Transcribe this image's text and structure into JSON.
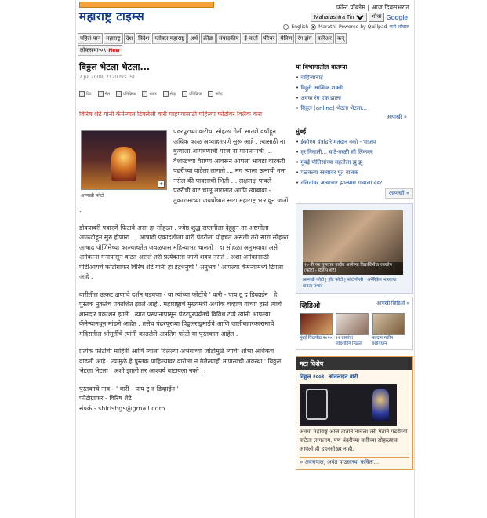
{
  "header": {
    "logo": "महाराष्ट्र टाइम्स",
    "toplinks": "फॉन्ट प्रॉब्लेम | आज दिवसभरात",
    "search_option": "Maharashtra Times",
    "search_button": "शोधा",
    "google": "Google",
    "lang_english": "English",
    "lang_marathi": "Marathi",
    "powered": "Powered by Quillpad",
    "powered_link": "कसे शोधाल"
  },
  "nav": {
    "row1": [
      "पहिलं पान",
      "महाराष्ट्र",
      "देश",
      "विदेश",
      "ग्लोबल महाराष्ट्र",
      "अर्थ",
      "क्रीडा",
      "संपादकीय",
      "ई-वार्ता",
      "फीचर",
      "मैत्रिण",
      "रंग झंग",
      "करिअर",
      "कन्"
    ],
    "row2_label": "लोकसभा-०९",
    "row2_badge": "New"
  },
  "article": {
    "title": "विठ्ठल भेटला भेटला...",
    "date": "2 Jul 2009, 2120 hrs IST",
    "tools": [
      "प्रिंट",
      "मेल",
      "प्रतिक्रिया",
      "शेअर",
      "सेव्ह",
      "प्रतिक्रिया",
      "फॉन्ट"
    ],
    "lead": "विरिष शेटे यांनी कॅमेऱ्यात टिपलेली वारी पाहण्यासाठी पहिल्या फोटोवर क्लिक करा.",
    "photo_caption": "आणखी फोटो",
    "para1": "पंढरपूरच्या वारीचा सोहळा गेली सातशे वर्षांहून अधिक काळ अव्याहतपणे सुरू आहे . त्यासाठी ना कुणाला आमंत्रणाची गरज ना मानपानाची ... वैशाखच्या वैराण्य आवरून आपला भावडा वारकरी पंढरीच्या वाटेला लागतो ... मग त्याला ऊनाची तमा नसेल की पावसाची भिती ... लक्षलक्ष पावले पंढरीची वाट चालू लागतात आणि त्याबाबा - तुकारामाच्या जयघोषात सारा महाराष्ट्र भारावून जातो .",
    "para2": "डोक्यावरी पवारणे फिटावे असा हा सोहळा . ज्येष्ठ शुद्ध सप्तमीला देहूहून तर अष्टमीला आळंदीहून सुरु होणारा ... आषाढी एकादशीला वारी पंढरीला पोहचत असली तरी सारा सोहळा आषाढ पौर्णिमेच्या काल्याचतेत जवळपास महिन्याभर चालतो . हा सोहळा अनुभवावा असे अनेकांना मनापासून वाटत असले तरी प्रत्येकाला जाणे शक्य नसते . अशा अनेकांसाठी पीटीआयचे फोटोग्राफर विरिष शेटे यांनी हा इंद्रधनुषी ' अनुभव ' आपल्या कॅमेऱ्यामध्ये टिपला आहे .",
    "para3": "वारीतील उत्कट क्षणांचे दर्शन घडवणा - या त्यांच्या फोटोंचे ' वारी - पाय टू द डिव्हाईन ' हे पुस्तक नुकतेच प्रकाशित झाले आहे . महाराष्ट्राचे मुख्यमंत्री अशोक चव्हाण यांच्या हस्ते त्याचे शानदार प्रकाशन झाले . त्यात प्रस्थानापासून पंढरपुरपर्यंतचे विविध टप्पे त्यांनी आपल्या कॅमेऱ्यामधून मांडले आहेत . तसेच पंढरपूरच्या विठ्ठलरखुमाईचे आणि जातीबहारकारामाचे मंदिरातील श्रीमूर्तीचे त्यांनी काढलेले अप्रतिम फोटो या पुस्तकात आहेत .",
    "para4": "प्रत्येक फोटोची माहिती आणि त्याला दिलेल्या अभंगाच्या जोडीमुळे त्याची शोभा अधिकच वाढली आहे . त्यामुळे हे पुस्तक पाहिल्यावर वारीला न गेलेल्याही माणसाची अवस्था ' विठ्ठल भेटला भेटला ' अशी झाली तर आश्चर्य वाटायला नको .",
    "book": "पुस्तकाचे नाव - ' वारी - पाय टू द डिव्हाईन '",
    "photographer": "फोटोग्राफर - विरिष शेटे",
    "contact": "संपर्क - shirishgs@gmail.com"
  },
  "sidebar": {
    "section1_title": "या विभागातील बातम्या",
    "section1_items": [
      "वाहिन्याबाई",
      "विठ्ठुरी आत्मिक शक्ती",
      "अवघा रंग एक झाला",
      "विठ्ठल (online) भेटला भेटला..."
    ],
    "section1_more": "आणखी »",
    "section2_title": "मुंबई",
    "section2_items": [
      "ईव्हीएम यंत्रांद्वारे मतदान नको - भाजप",
      "दूर निघाली... घाटे-वरळी सी लिंकवर",
      "मुंबई पोलिसांच्या महतीला झु झु",
      "पळवल्या रस्त्यावर मूत बालक",
      "दलितांवर अत्याचार झाल्यास गावाला दंड?"
    ],
    "section2_more": "आणखी »",
    "photo_caption": "१० वी च्या गुणवत्ता यादीत आलेल्या विद्यार्थिनींचा जल्लोष (फोटो - दिलीप शेटे)",
    "photo_links": "आणखी फोटो | हॉट फोटो | फोटोगॅलरी | अमेरिकेत भारताचा वाढता प्रभाव",
    "video_title": "व्हिडिओ",
    "video_more": "आणखी व्हिडिओ »",
    "videos": [
      "मुंबई विद्यापीठ २०१०",
      "१२ तासांचा लोडशेडिंग मिळेल",
      "मतदान मशीन प्रश्नविधान"
    ],
    "special_title": "मटा विशेष",
    "special_link": "विठ्ठल २००९. ऑनलाइन वारी",
    "special_text": "अवघा महाराष्ट्र आज ताताने नाचला तरी मताने पंढरीच्या वाटेला लागलाय. पण पंढरीच्या वारीच्या सोहळ्याचा आपली ही दहनसौख्य नाही.",
    "special_foot": "» अवचपाल, अनंत पाउसाच्या कविता..."
  }
}
